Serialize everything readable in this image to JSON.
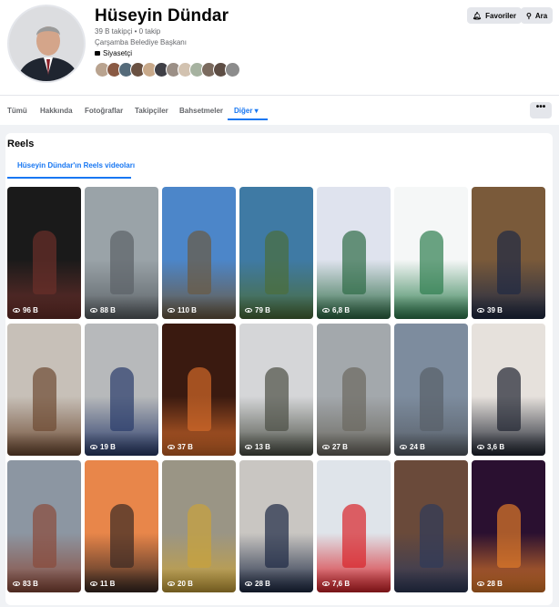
{
  "profile": {
    "name": "Hüseyin Dündar",
    "stats": "39 B takipçi • 0 takip",
    "title": "Çarşamba Belediye Başkanı",
    "category": "Siyasetçi",
    "favorites_label": "Favoriler",
    "search_label": "Ara"
  },
  "followers_colors": [
    "#b9a38f",
    "#8a5a44",
    "#556b7a",
    "#6a5142",
    "#c8a98a",
    "#3f3f46",
    "#9b8f86",
    "#d2c2b0",
    "#a6b2a0",
    "#7a6a5e",
    "#5d4d44",
    "#8c8c8c"
  ],
  "tabs": [
    "Tümü",
    "Hakkında",
    "Fotoğraflar",
    "Takipçiler",
    "Bahsetmeler",
    "Diğer ▾"
  ],
  "more_label": "•••",
  "reels": {
    "title": "Reels",
    "subtab": "Hüseyin Dündar'ın Reels videoları",
    "items": [
      {
        "views": "96 B",
        "bg": "#1a1a1a",
        "accent": "#6b2f2a"
      },
      {
        "views": "88 B",
        "bg": "#9aa3a8",
        "accent": "#5b6166"
      },
      {
        "views": "110 B",
        "bg": "#4c86c9",
        "accent": "#6b5a42"
      },
      {
        "views": "79 B",
        "bg": "#3f7aa4",
        "accent": "#4b6d3a"
      },
      {
        "views": "6,8 B",
        "bg": "#dfe3ee",
        "accent": "#2e6b46"
      },
      {
        "views": "",
        "bg": "#f5f7f7",
        "accent": "#2e7d4f"
      },
      {
        "views": "39 B",
        "bg": "#7a5a3a",
        "accent": "#1f2a44"
      },
      {
        "views": "",
        "bg": "#c7c0b8",
        "accent": "#6d4a32"
      },
      {
        "views": "19 B",
        "bg": "#b7b9bb",
        "accent": "#2a3c6b"
      },
      {
        "views": "37 B",
        "bg": "#3a1a10",
        "accent": "#d2692a"
      },
      {
        "views": "13 B",
        "bg": "#d5d6d8",
        "accent": "#4b4f45"
      },
      {
        "views": "27 B",
        "bg": "#a3a8ac",
        "accent": "#6b6860"
      },
      {
        "views": "24 B",
        "bg": "#7d8c9e",
        "accent": "#585f68"
      },
      {
        "views": "3,6 B",
        "bg": "#e6e1dc",
        "accent": "#1f2430"
      },
      {
        "views": "83 B",
        "bg": "#8c96a2",
        "accent": "#8a4a3a"
      },
      {
        "views": "11 B",
        "bg": "#e8864a",
        "accent": "#3a2a24"
      },
      {
        "views": "20 B",
        "bg": "#9a9585",
        "accent": "#c9a23a"
      },
      {
        "views": "28 B",
        "bg": "#c9c6c2",
        "accent": "#1e2a44"
      },
      {
        "views": "7,6 B",
        "bg": "#dfe4ea",
        "accent": "#d8242a"
      },
      {
        "views": "",
        "bg": "#6a4a3a",
        "accent": "#2f3a5a"
      },
      {
        "views": "28 B",
        "bg": "#2a1030",
        "accent": "#e07a2a"
      }
    ]
  }
}
